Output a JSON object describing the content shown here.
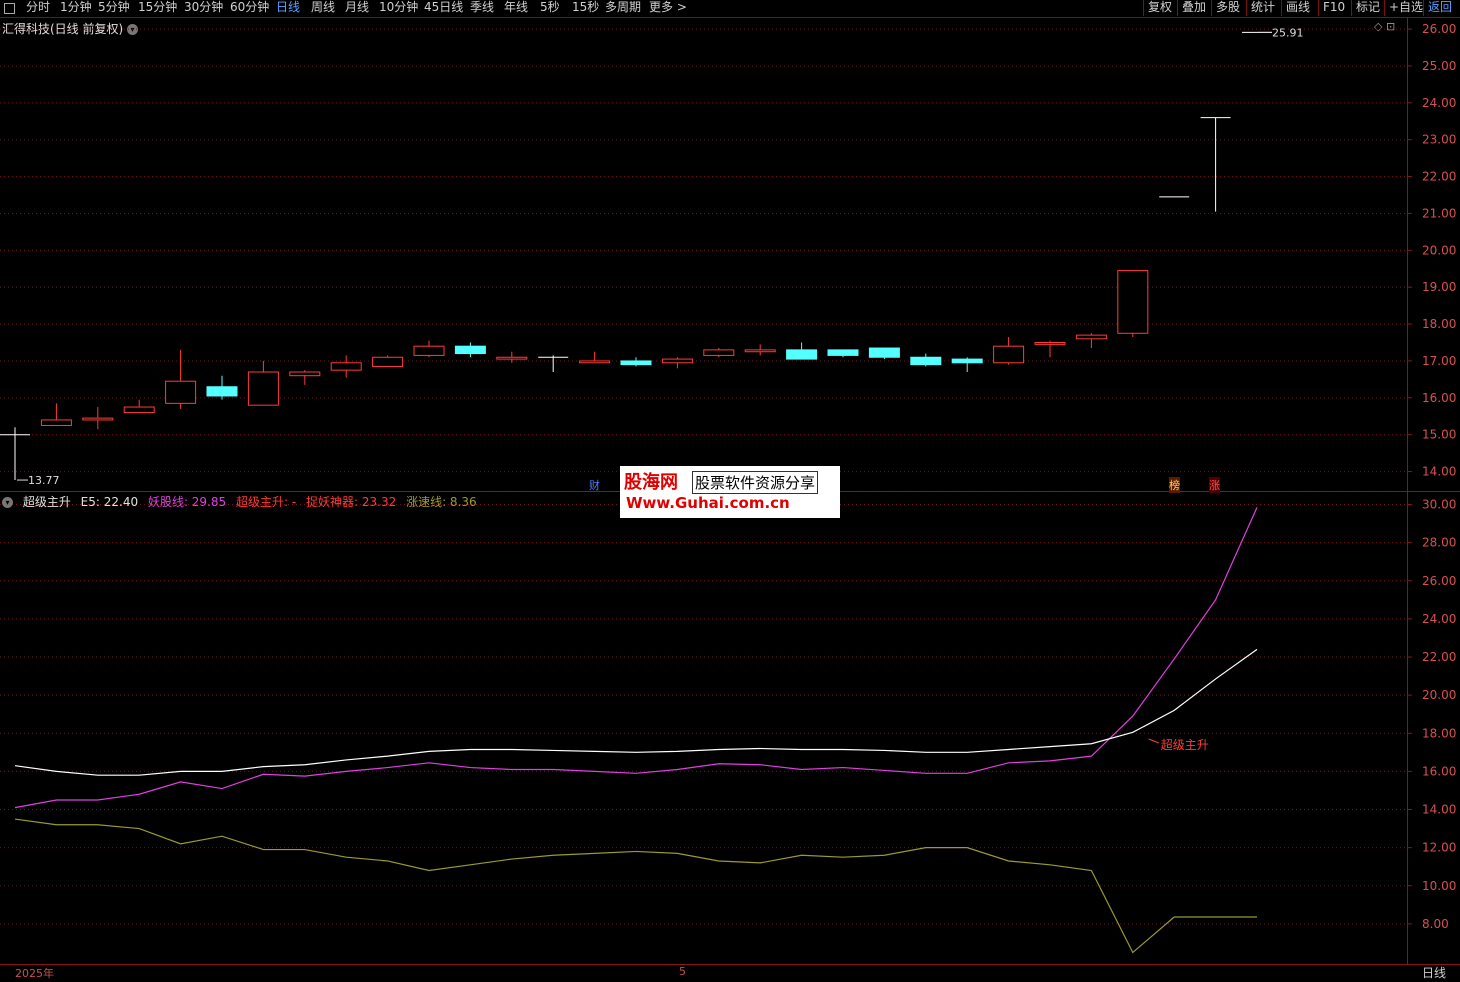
{
  "toolbar": {
    "periods": [
      "分时",
      "1分钟",
      "5分钟",
      "15分钟",
      "30分钟",
      "60分钟",
      "日线",
      "周线",
      "月线",
      "10分钟",
      "45日线",
      "季线",
      "年线",
      "5秒",
      "15秒",
      "多周期",
      "更多 >"
    ],
    "active_period": "日线",
    "right_buttons": [
      "复权",
      "叠加",
      "多股",
      "统计",
      "画线",
      "F10",
      "标记",
      "+自选",
      "返回"
    ],
    "active_right": "返回"
  },
  "chart_title": "汇得科技(日线 前复权)",
  "price_axis": {
    "ticks": [
      "26.00",
      "25.00",
      "24.00",
      "23.00",
      "22.00",
      "21.00",
      "20.00",
      "19.00",
      "18.00",
      "17.00",
      "16.00",
      "15.00",
      "14.00"
    ],
    "max_label": "25.91",
    "min_label": "13.77"
  },
  "markers": {
    "cai": "财",
    "bang": "榜",
    "zhang": "涨"
  },
  "indicator": {
    "name": "超级主升",
    "e5": "E5: 22.40",
    "yaogu": "妖股线: 29.85",
    "chaoji": "超级主升: -",
    "zhuoyao": "捉妖神器: 23.32",
    "zhangsu": "涨速线: 8.36",
    "annotation": "超级主升",
    "ticks": [
      "30.00",
      "28.00",
      "26.00",
      "24.00",
      "22.00",
      "20.00",
      "18.00",
      "16.00",
      "14.00",
      "12.00",
      "10.00",
      "8.00"
    ]
  },
  "watermark": {
    "brand": "股海网",
    "slogan": "股票软件资源分享",
    "url": "Www.Guhai.com.cn"
  },
  "dates": {
    "year": "2025年",
    "month": "5"
  },
  "period_label": "日线",
  "colors": {
    "up": "#ff3b3b",
    "down": "#54ffff",
    "grid": "#7a1010",
    "e5": "#ffffff",
    "yaogu": "#e040e0",
    "zhangsu": "#9a9a30"
  },
  "chart_data": {
    "type": "candlestick",
    "candles": [
      {
        "o": 15.0,
        "c": 15.0,
        "h": 15.2,
        "l": 13.77
      },
      {
        "o": 15.25,
        "c": 15.4,
        "h": 15.85,
        "l": 15.25
      },
      {
        "o": 15.4,
        "c": 15.45,
        "h": 15.75,
        "l": 15.15
      },
      {
        "o": 15.6,
        "c": 15.75,
        "h": 15.95,
        "l": 15.6
      },
      {
        "o": 15.85,
        "c": 16.45,
        "h": 17.3,
        "l": 15.7
      },
      {
        "o": 16.3,
        "c": 16.05,
        "h": 16.6,
        "l": 15.95
      },
      {
        "o": 15.8,
        "c": 16.7,
        "h": 17.0,
        "l": 15.8
      },
      {
        "o": 16.6,
        "c": 16.7,
        "h": 16.75,
        "l": 16.35
      },
      {
        "o": 16.75,
        "c": 16.95,
        "h": 17.15,
        "l": 16.55
      },
      {
        "o": 16.85,
        "c": 17.1,
        "h": 17.15,
        "l": 16.85
      },
      {
        "o": 17.15,
        "c": 17.4,
        "h": 17.55,
        "l": 17.1
      },
      {
        "o": 17.4,
        "c": 17.2,
        "h": 17.5,
        "l": 17.1
      },
      {
        "o": 17.05,
        "c": 17.1,
        "h": 17.25,
        "l": 16.95
      },
      {
        "o": 17.1,
        "c": 17.1,
        "h": 17.15,
        "l": 16.7
      },
      {
        "o": 16.95,
        "c": 17.0,
        "h": 17.25,
        "l": 16.95
      },
      {
        "o": 17.0,
        "c": 16.9,
        "h": 17.1,
        "l": 16.85
      },
      {
        "o": 16.95,
        "c": 17.05,
        "h": 17.1,
        "l": 16.8
      },
      {
        "o": 17.15,
        "c": 17.3,
        "h": 17.35,
        "l": 17.1
      },
      {
        "o": 17.25,
        "c": 17.3,
        "h": 17.45,
        "l": 17.15
      },
      {
        "o": 17.3,
        "c": 17.05,
        "h": 17.5,
        "l": 17.05
      },
      {
        "o": 17.3,
        "c": 17.15,
        "h": 17.3,
        "l": 17.1
      },
      {
        "o": 17.35,
        "c": 17.1,
        "h": 17.35,
        "l": 17.05
      },
      {
        "o": 17.1,
        "c": 16.9,
        "h": 17.2,
        "l": 16.85
      },
      {
        "o": 17.05,
        "c": 16.95,
        "h": 17.1,
        "l": 16.7
      },
      {
        "o": 16.95,
        "c": 17.4,
        "h": 17.65,
        "l": 16.9
      },
      {
        "o": 17.45,
        "c": 17.5,
        "h": 17.55,
        "l": 17.1
      },
      {
        "o": 17.6,
        "c": 17.7,
        "h": 17.75,
        "l": 17.35
      },
      {
        "o": 17.75,
        "c": 19.45,
        "h": 19.45,
        "l": 17.65
      },
      {
        "o": 21.45,
        "c": 21.45,
        "h": 21.45,
        "l": 21.45
      },
      {
        "o": 23.6,
        "c": 23.6,
        "h": 23.6,
        "l": 21.05
      },
      {
        "o": 25.91,
        "c": 25.91,
        "h": 25.91,
        "l": 25.91
      }
    ],
    "price_ylim": [
      13.5,
      26.3
    ],
    "e5": [
      16.3,
      16.0,
      15.8,
      15.8,
      16.0,
      16.0,
      16.25,
      16.35,
      16.6,
      16.8,
      17.05,
      17.15,
      17.15,
      17.1,
      17.05,
      17.0,
      17.05,
      17.15,
      17.2,
      17.15,
      17.15,
      17.1,
      17.0,
      17.0,
      17.15,
      17.3,
      17.45,
      18.05,
      19.2,
      20.85,
      22.4
    ],
    "yaogu": [
      14.1,
      14.5,
      14.5,
      14.8,
      15.45,
      15.1,
      15.85,
      15.75,
      16.0,
      16.2,
      16.45,
      16.2,
      16.1,
      16.1,
      16.0,
      15.9,
      16.1,
      16.4,
      16.35,
      16.1,
      16.2,
      16.05,
      15.9,
      15.9,
      16.45,
      16.55,
      16.8,
      18.9,
      21.9,
      25.0,
      29.85
    ],
    "zhangsu": [
      13.5,
      13.2,
      13.2,
      13.0,
      12.2,
      12.6,
      11.9,
      11.9,
      11.5,
      11.3,
      10.8,
      11.1,
      11.4,
      11.6,
      11.7,
      11.8,
      11.7,
      11.3,
      11.2,
      11.6,
      11.5,
      11.6,
      12.0,
      12.0,
      11.3,
      11.1,
      10.8,
      6.5,
      8.36,
      8.36,
      8.36
    ],
    "ind_ylim": [
      6.0,
      30.5
    ]
  }
}
